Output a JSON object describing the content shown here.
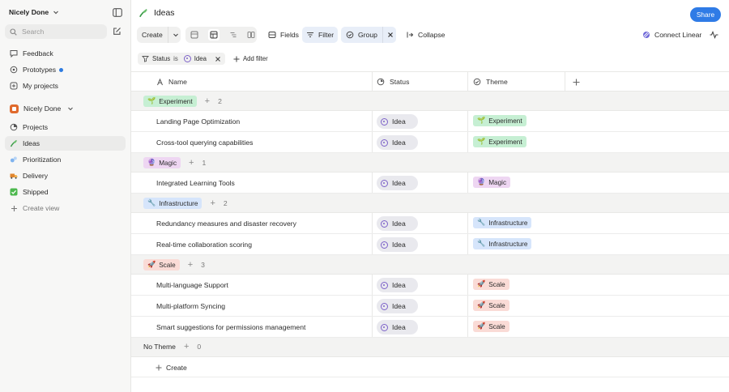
{
  "sidebar": {
    "workspace": "Nicely Done",
    "search_placeholder": "Search",
    "top_items": [
      {
        "label": "Feedback"
      },
      {
        "label": "Prototypes"
      },
      {
        "label": "My projects"
      }
    ],
    "team": "Nicely Done",
    "team_items": [
      {
        "label": "Projects"
      },
      {
        "label": "Ideas"
      },
      {
        "label": "Prioritization"
      },
      {
        "label": "Delivery"
      },
      {
        "label": "Shipped"
      },
      {
        "label": "Create view"
      }
    ]
  },
  "header": {
    "title": "Ideas",
    "share": "Share"
  },
  "toolbar": {
    "create": "Create",
    "fields": "Fields",
    "filter": "Filter",
    "group": "Group",
    "collapse": "Collapse",
    "connect": "Connect Linear"
  },
  "filterbar": {
    "field": "Status",
    "op": "is",
    "value": "Idea",
    "add": "Add filter"
  },
  "columns": {
    "name": "Name",
    "status": "Status",
    "theme": "Theme"
  },
  "groups": [
    {
      "label": "Experiment",
      "count": "2",
      "rows": [
        {
          "name": "Landing Page Optimization",
          "status": "Idea",
          "theme": "Experiment"
        },
        {
          "name": "Cross-tool querying capabilities",
          "status": "Idea",
          "theme": "Experiment"
        }
      ]
    },
    {
      "label": "Magic",
      "count": "1",
      "rows": [
        {
          "name": "Integrated Learning Tools",
          "status": "Idea",
          "theme": "Magic"
        }
      ]
    },
    {
      "label": "Infrastructure",
      "count": "2",
      "rows": [
        {
          "name": "Redundancy measures and disaster recovery",
          "status": "Idea",
          "theme": "Infrastructure"
        },
        {
          "name": "Real-time collaboration scoring",
          "status": "Idea",
          "theme": "Infrastructure"
        }
      ]
    },
    {
      "label": "Scale",
      "count": "3",
      "rows": [
        {
          "name": "Multi-language Support",
          "status": "Idea",
          "theme": "Scale"
        },
        {
          "name": "Multi-platform Syncing",
          "status": "Idea",
          "theme": "Scale"
        },
        {
          "name": "Smart suggestions for permissions management",
          "status": "Idea",
          "theme": "Scale"
        }
      ]
    },
    {
      "label": "No Theme",
      "count": "0",
      "rows": []
    }
  ],
  "create_row": "Create",
  "colors": {
    "accent": "#2f7be6",
    "experiment": "#c6efd3",
    "magic": "#eed6f2",
    "infrastructure": "#d6e5fb",
    "scale": "#fadbd6"
  }
}
